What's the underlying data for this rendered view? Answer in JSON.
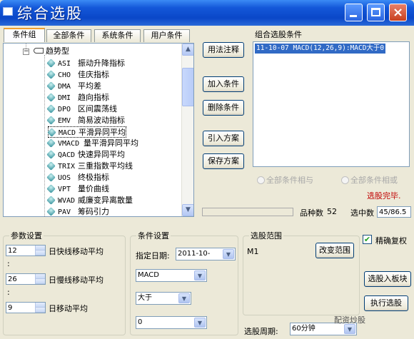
{
  "window": {
    "title": "综合选股",
    "close_glyph": "×"
  },
  "tabs": [
    {
      "label": "条件组",
      "active": true
    },
    {
      "label": "全部条件",
      "active": false
    },
    {
      "label": "系统条件",
      "active": false
    },
    {
      "label": "用户条件",
      "active": false
    }
  ],
  "tree": {
    "root_label": "趋势型",
    "root_expander": "−",
    "items": [
      {
        "code": "ASI",
        "name": "振动升降指标"
      },
      {
        "code": "CHO",
        "name": "佳庆指标"
      },
      {
        "code": "DMA",
        "name": "平均差"
      },
      {
        "code": "DMI",
        "name": "趋向指标"
      },
      {
        "code": "DPO",
        "name": "区间震荡线"
      },
      {
        "code": "EMV",
        "name": "简易波动指标"
      },
      {
        "code": "MACD",
        "name": "平滑异同平均"
      },
      {
        "code": "VMACD",
        "name": "量平滑异同平均"
      },
      {
        "code": "QACD",
        "name": "快速异同平均"
      },
      {
        "code": "TRIX",
        "name": "三重指数平均线"
      },
      {
        "code": "UOS",
        "name": "终极指标"
      },
      {
        "code": "VPT",
        "name": "量价曲线"
      },
      {
        "code": "WVAD",
        "name": "威廉变异离散量"
      },
      {
        "code": "PAV",
        "name": "筹码引力"
      }
    ],
    "scroll_up": "▲",
    "scroll_down": "▼"
  },
  "buttons": {
    "usage": "用法注释",
    "add_condition": "加入条件",
    "delete_condition": "删除条件",
    "import_scheme": "引入方案",
    "save_scheme": "保存方案",
    "change_range": "改变范围",
    "add_to_block": "选股入板块",
    "execute": "执行选股"
  },
  "combo_conditions": {
    "label": "组合选股条件",
    "items": [
      "11-10-07 MACD(12,26,9):MACD大于0"
    ]
  },
  "radios": {
    "all_and": "全部条件相与",
    "all_or": "全部条件相或"
  },
  "status": {
    "done": "选股完毕.",
    "variety_label": "品种数",
    "variety_count": "52",
    "selected_label": "选中数",
    "selected_value": "45/86.5"
  },
  "params": {
    "legend": "参数设置",
    "rows": [
      {
        "value": "12",
        "label": "日快线移动平均"
      },
      {
        "value": "26",
        "label": "日慢线移动平均"
      },
      {
        "value": "9",
        "label": "日移动平均"
      }
    ],
    "separator": ":"
  },
  "condition_settings": {
    "legend": "条件设置",
    "date_label": "指定日期:",
    "date_value": "2011-10-",
    "indicator": "MACD",
    "operator": "大于",
    "threshold": "0",
    "arrow": "▼"
  },
  "range": {
    "legend": "选股范围",
    "value": "M1"
  },
  "options": {
    "exact_rights": "精确复权",
    "checked_mark": "✔"
  },
  "period": {
    "label": "选股周期:",
    "value": "60分钟"
  },
  "watermark": "配资炒股"
}
